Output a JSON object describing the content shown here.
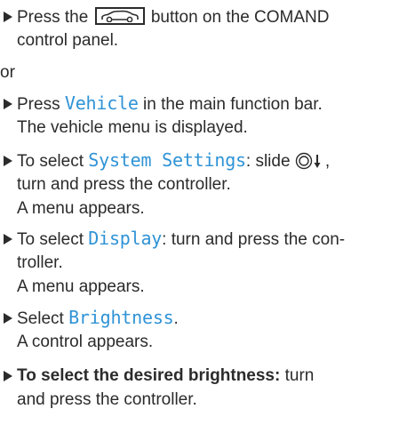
{
  "steps": [
    {
      "lines": [
        {
          "pre": "Press the",
          "post": "button on the COMAND"
        },
        {
          "text": "control panel."
        }
      ],
      "car_button_icon": "car-vehicle-button-icon"
    },
    {
      "lines": [
        {
          "pre": "Press ",
          "keyword": "Vehicle",
          "post": " in the main function bar."
        },
        {
          "text": "The vehicle menu is displayed."
        }
      ]
    },
    {
      "lines": [
        {
          "pre": "To select ",
          "keyword": "System Settings",
          "post": ": slide",
          "post2": ","
        },
        {
          "text": "turn and press the controller."
        },
        {
          "text": "A menu appears."
        }
      ],
      "controller_icon": "controller-slide-down-icon"
    },
    {
      "lines": [
        {
          "pre": "To select ",
          "keyword": "Display",
          "post": ": turn and press the con-"
        },
        {
          "text": "troller."
        },
        {
          "text": "A menu appears."
        }
      ]
    },
    {
      "lines": [
        {
          "pre": "Select ",
          "keyword": "Brightness",
          "post": "."
        },
        {
          "text": "A control appears."
        }
      ]
    },
    {
      "lines": [
        {
          "bold": "To select the desired brightness:",
          "post": " turn"
        },
        {
          "text": "and press the controller."
        }
      ]
    }
  ],
  "separator": "or",
  "colors": {
    "text": "#2b2b2b",
    "keyword": "#2f93d6"
  },
  "bullet_icon": "triangle-bullet-icon"
}
